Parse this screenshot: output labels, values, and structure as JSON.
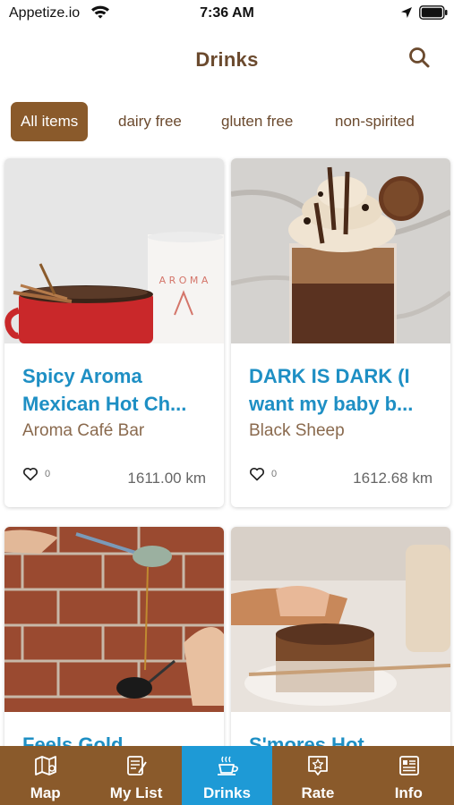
{
  "status_bar": {
    "carrier": "Appetize.io",
    "time": "7:36 AM",
    "icons": [
      "wifi-icon",
      "location-icon",
      "battery-icon"
    ]
  },
  "header": {
    "title": "Drinks",
    "search_icon": "search-icon"
  },
  "filters": [
    {
      "label": "All items",
      "active": true
    },
    {
      "label": "dairy free",
      "active": false
    },
    {
      "label": "gluten free",
      "active": false
    },
    {
      "label": "non-spirited",
      "active": false
    }
  ],
  "cards": [
    {
      "title_line1": "Spicy Aroma",
      "title_line2": "Mexican Hot Ch...",
      "venue": "Aroma Café Bar",
      "likes": "0",
      "distance": "1611.00 km"
    },
    {
      "title_line1": "DARK IS DARK (I",
      "title_line2": "want my baby b...",
      "venue": "Black Sheep",
      "likes": "0",
      "distance": "1612.68 km"
    },
    {
      "title_line1": "Feels Gold",
      "title_line2": "",
      "venue": "",
      "likes": "",
      "distance": ""
    },
    {
      "title_line1": "S'mores Hot",
      "title_line2": "",
      "venue": "",
      "likes": "",
      "distance": ""
    }
  ],
  "nav": [
    {
      "label": "Map",
      "icon": "map-icon",
      "active": false
    },
    {
      "label": "My List",
      "icon": "list-icon",
      "active": false
    },
    {
      "label": "Drinks",
      "icon": "coffee-cup-icon",
      "active": true
    },
    {
      "label": "Rate",
      "icon": "star-badge-icon",
      "active": false
    },
    {
      "label": "Info",
      "icon": "info-card-icon",
      "active": false
    }
  ],
  "colors": {
    "brand_brown": "#8a5a2b",
    "title_brown": "#6b4a2e",
    "accent_blue": "#1e8fc4",
    "nav_active_blue": "#1e9ad6"
  }
}
